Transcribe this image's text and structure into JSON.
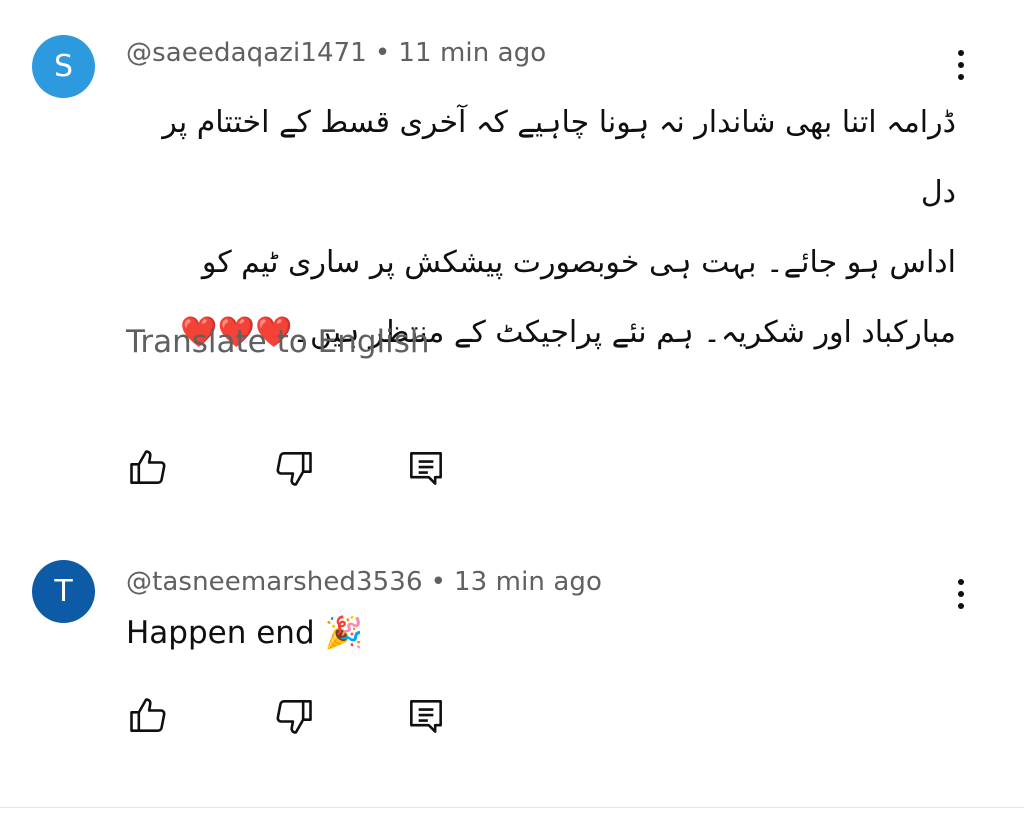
{
  "comments": [
    {
      "avatar_letter": "S",
      "avatar_color": "#2d9ae0",
      "author": "@saeedaqazi1471",
      "separator": "•",
      "time": "11 min ago",
      "text_lines": [
        "ڈرامہ اتنا بھی شاندار نہ ہونا چاہیے کہ آخری قسط کے اختتام پر دل",
        "اداس ہو جائے۔ بہت ہی خوبصورت پیشکش پر ساری ٹیم کو",
        "مبارکباد اور شکریہ۔ ہم نئے پراجیکٹ کے منتظر ہیں۔❤️❤️❤️"
      ],
      "translate_label": "Translate to English"
    },
    {
      "avatar_letter": "T",
      "avatar_color": "#0d5aa7",
      "author": "@tasneemarshed3536",
      "separator": "•",
      "time": "13 min ago",
      "text": "Happen end 🎉"
    }
  ],
  "icons": {
    "like": "thumbs-up-icon",
    "dislike": "thumbs-down-icon",
    "reply": "reply-icon",
    "more": "more-vert-icon"
  }
}
